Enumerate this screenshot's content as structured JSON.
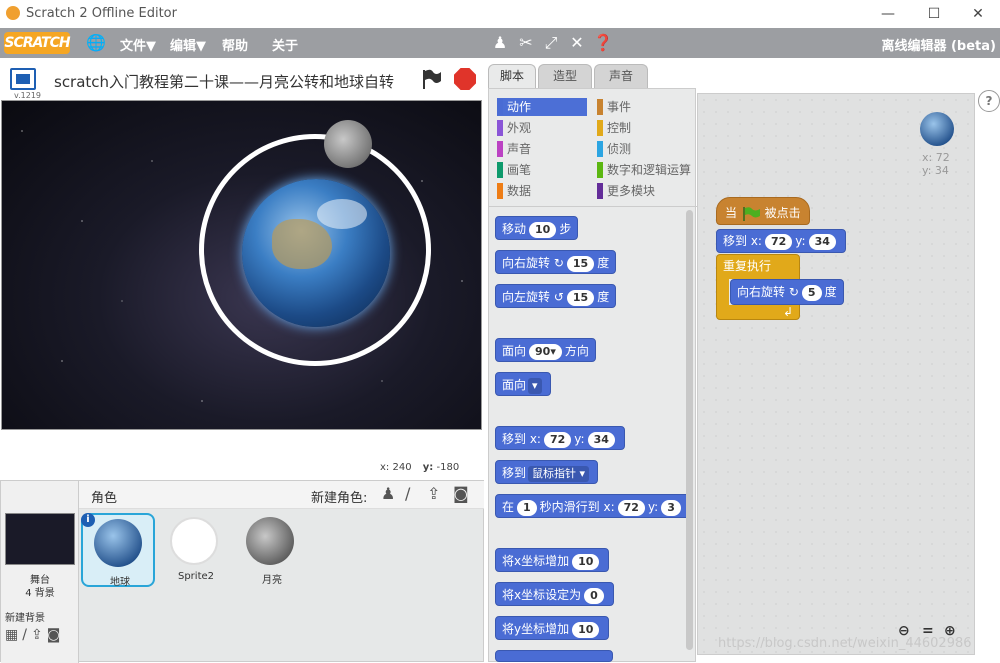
{
  "window": {
    "title": "Scratch 2 Offline Editor",
    "minimize": "—",
    "maximize": "☐",
    "close": "✕"
  },
  "menu": {
    "logo": "SCRATCH",
    "file": "文件▼",
    "edit": "编辑▼",
    "help": "帮助",
    "about": "关于",
    "version": "离线编辑器 (beta)",
    "tools": [
      "duplicate-icon",
      "delete-icon",
      "grow-icon",
      "shrink-icon",
      "help-icon"
    ]
  },
  "stage": {
    "title": "scratch入门教程第二十课——月亮公转和地球自转",
    "version": "v.1219",
    "coords": {
      "x_label": "x:",
      "x": "240",
      "y_label": "y:",
      "y": "-180"
    }
  },
  "sprites_pane": {
    "heading": "角色",
    "new_sprite": "新建角色:",
    "stage_label": "舞台",
    "stage_sub": "4 背景",
    "new_bg": "新建背景",
    "sprites": [
      {
        "name": "地球",
        "selected": true
      },
      {
        "name": "Sprite2",
        "selected": false
      },
      {
        "name": "月亮",
        "selected": false
      }
    ]
  },
  "tabs": [
    "脚本",
    "造型",
    "声音"
  ],
  "categories": [
    {
      "label": "动作",
      "color": "#4a6cd4",
      "active": true
    },
    {
      "label": "事件",
      "color": "#c88330"
    },
    {
      "label": "外观",
      "color": "#8a55d7"
    },
    {
      "label": "控制",
      "color": "#e1a91a"
    },
    {
      "label": "声音",
      "color": "#bb42c3"
    },
    {
      "label": "侦测",
      "color": "#2ca5e2"
    },
    {
      "label": "画笔",
      "color": "#0e9a6c"
    },
    {
      "label": "数字和逻辑运算",
      "color": "#5cb712"
    },
    {
      "label": "数据",
      "color": "#ee7d16"
    },
    {
      "label": "更多模块",
      "color": "#632d99"
    }
  ],
  "palette_blocks": {
    "move": {
      "a": "移动",
      "n": "10",
      "b": "步"
    },
    "turn_right": {
      "a": "向右旋转",
      "icon": "↻",
      "n": "15",
      "b": "度"
    },
    "turn_left": {
      "a": "向左旋转",
      "icon": "↺",
      "n": "15",
      "b": "度"
    },
    "point_dir": {
      "a": "面向",
      "n": "90▾",
      "b": "方向"
    },
    "point_towards": {
      "a": "面向",
      "dd": "▾"
    },
    "goto_xy": {
      "a": "移到 x:",
      "x": "72",
      "b": "y:",
      "y": "34"
    },
    "goto_target": {
      "a": "移到",
      "dd": "鼠标指针 ▾"
    },
    "glide": {
      "a": "在",
      "n": "1",
      "b": "秒内滑行到 x:",
      "x": "72",
      "c": "y:",
      "y": "3"
    },
    "change_x": {
      "a": "将x坐标增加",
      "n": "10"
    },
    "set_x": {
      "a": "将x坐标设定为",
      "n": "0"
    },
    "change_y": {
      "a": "将y坐标增加",
      "n": "10"
    }
  },
  "script": {
    "hat": {
      "a": "当",
      "b": "被点击"
    },
    "goto": {
      "a": "移到 x:",
      "x": "72",
      "b": "y:",
      "y": "34"
    },
    "repeat": "重复执行",
    "turn": {
      "a": "向右旋转",
      "icon": "↻",
      "n": "5",
      "b": "度"
    },
    "loop_arrow": "↲"
  },
  "sprite_info": {
    "x_label": "x:",
    "x": "72",
    "y_label": "y:",
    "y": "34"
  },
  "zoom": {
    "out": "🔍−",
    "reset": "=",
    "in": "🔍+"
  },
  "watermark": "https://blog.csdn.net/weixin_44602986",
  "help_btn": "?"
}
